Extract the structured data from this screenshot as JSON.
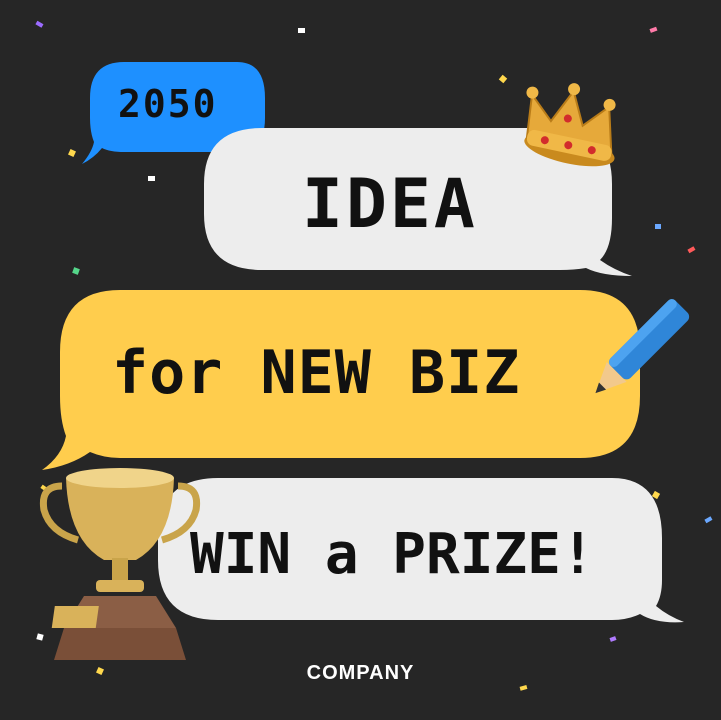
{
  "badge": {
    "text": "2050",
    "color": "#1e90ff"
  },
  "lines": [
    {
      "text": "IDEA",
      "color": "#ededed"
    },
    {
      "text": "for NEW BIZ",
      "color": "#ffcd4d"
    },
    {
      "text": "WIN a PRIZE!",
      "color": "#ededed"
    }
  ],
  "footer": {
    "text": "COMPANY"
  },
  "icons": [
    "crown-icon",
    "pencil-icon",
    "trophy-icon"
  ],
  "colors": {
    "background": "#262626",
    "text": "#111111"
  }
}
